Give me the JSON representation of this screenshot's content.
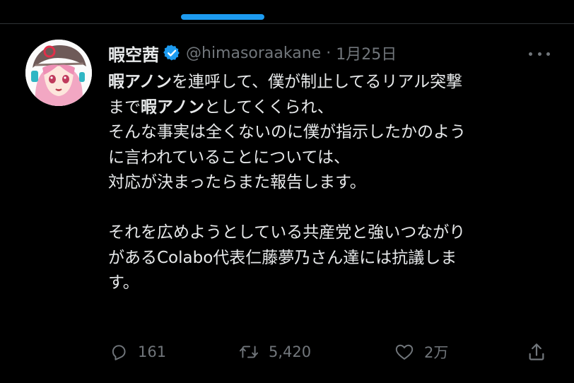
{
  "colors": {
    "background": "#000000",
    "text_primary": "#e7e9ea",
    "text_secondary": "#71767b",
    "accent_blue": "#1d9bf0",
    "divider": "#2f3336"
  },
  "tweet": {
    "author": {
      "display_name": "暇空茜",
      "handle": "@himasoraakane",
      "verified_icon": "verified-badge-icon"
    },
    "separator": "·",
    "date": "1月25日",
    "lines": [
      {
        "b1": "暇アノン",
        "t1": "を連呼して、僕が制止してるリアル突撃"
      },
      {
        "t0": "まで",
        "b1": "暇アノン",
        "t1": "としてくくられ、"
      },
      {
        "t0": "そんな事実は全くないのに僕が指示したかのよう"
      },
      {
        "t0": "に言われていることについては、"
      },
      {
        "t0": "対応が決まったらまた報告します。"
      },
      {
        "t0": "それを広めようとしている共産党と強いつながり"
      },
      {
        "t0": "があるColabo代表仁藤夢乃さん達には抗議しま"
      },
      {
        "t0": "す。"
      }
    ],
    "actions": {
      "reply_count": "161",
      "retweet_count": "5,420",
      "like_count": "2万"
    }
  },
  "icons": {
    "more": "more-icon",
    "reply": "reply-icon",
    "retweet": "retweet-icon",
    "like": "heart-icon",
    "share": "share-icon"
  }
}
